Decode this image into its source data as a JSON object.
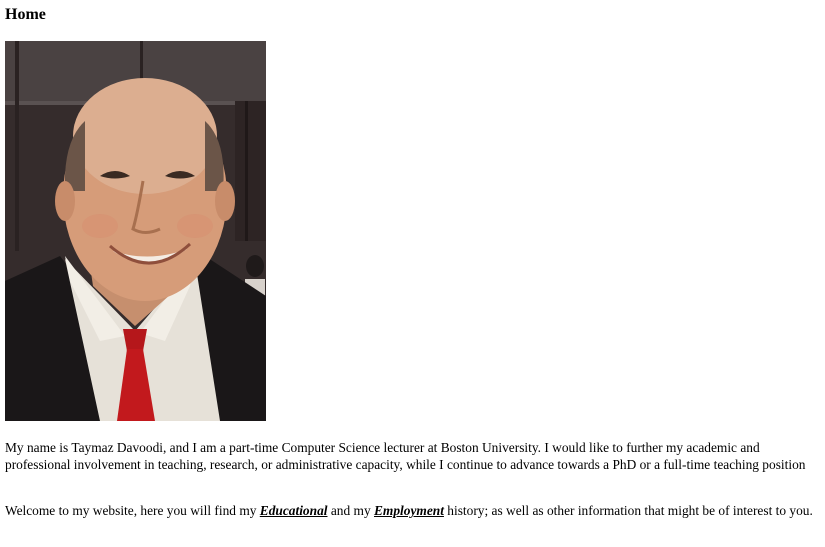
{
  "header": {
    "title": "Home"
  },
  "intro": {
    "text": "My name is Taymaz Davoodi, and I am a part-time Computer Science lecturer at Boston University. I would like to further my academic and professional involvement in teaching, research, or administrative capacity, while I continue to advance towards a PhD or a full-time teaching position"
  },
  "welcome": {
    "before_educational": "Welcome to my website, here you will find my ",
    "educational_link": "Educational",
    "between": " and my ",
    "employment_link": "Employment",
    "after": " history; as well as other information that might be of interest to you."
  }
}
